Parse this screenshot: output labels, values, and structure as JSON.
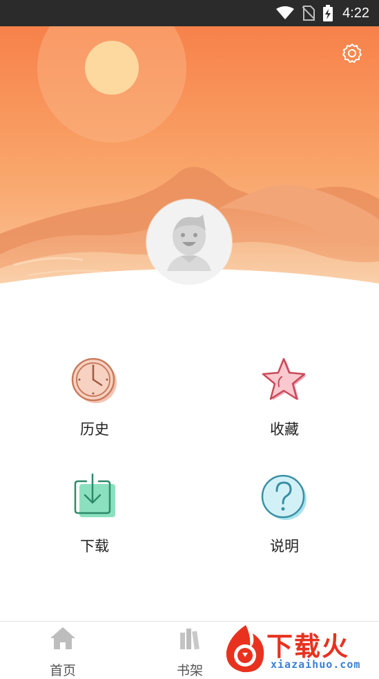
{
  "status_bar": {
    "time": "4:22",
    "icons": [
      "wifi-icon",
      "no-sim-icon",
      "battery-charging-icon"
    ]
  },
  "header": {
    "settings_icon": "gear-icon",
    "avatar_icon": "default-avatar-icon",
    "colors": {
      "sky_top": "#f7814a",
      "sky_bottom": "#fbc49a",
      "sun": "#fdd9a0"
    }
  },
  "menu": {
    "items": [
      {
        "label": "历史",
        "icon": "clock-icon",
        "color": "#e8a78f"
      },
      {
        "label": "收藏",
        "icon": "star-icon",
        "color": "#f5b6bf"
      },
      {
        "label": "下载",
        "icon": "download-icon",
        "color": "#8be0c0"
      },
      {
        "label": "说明",
        "icon": "help-icon",
        "color": "#a9e2ee"
      }
    ]
  },
  "tabs": [
    {
      "label": "首页",
      "icon": "home-icon"
    },
    {
      "label": "书架",
      "icon": "bookshelf-icon"
    }
  ],
  "watermark": {
    "text": "下载火",
    "sub": "xiazaihuo.com"
  }
}
